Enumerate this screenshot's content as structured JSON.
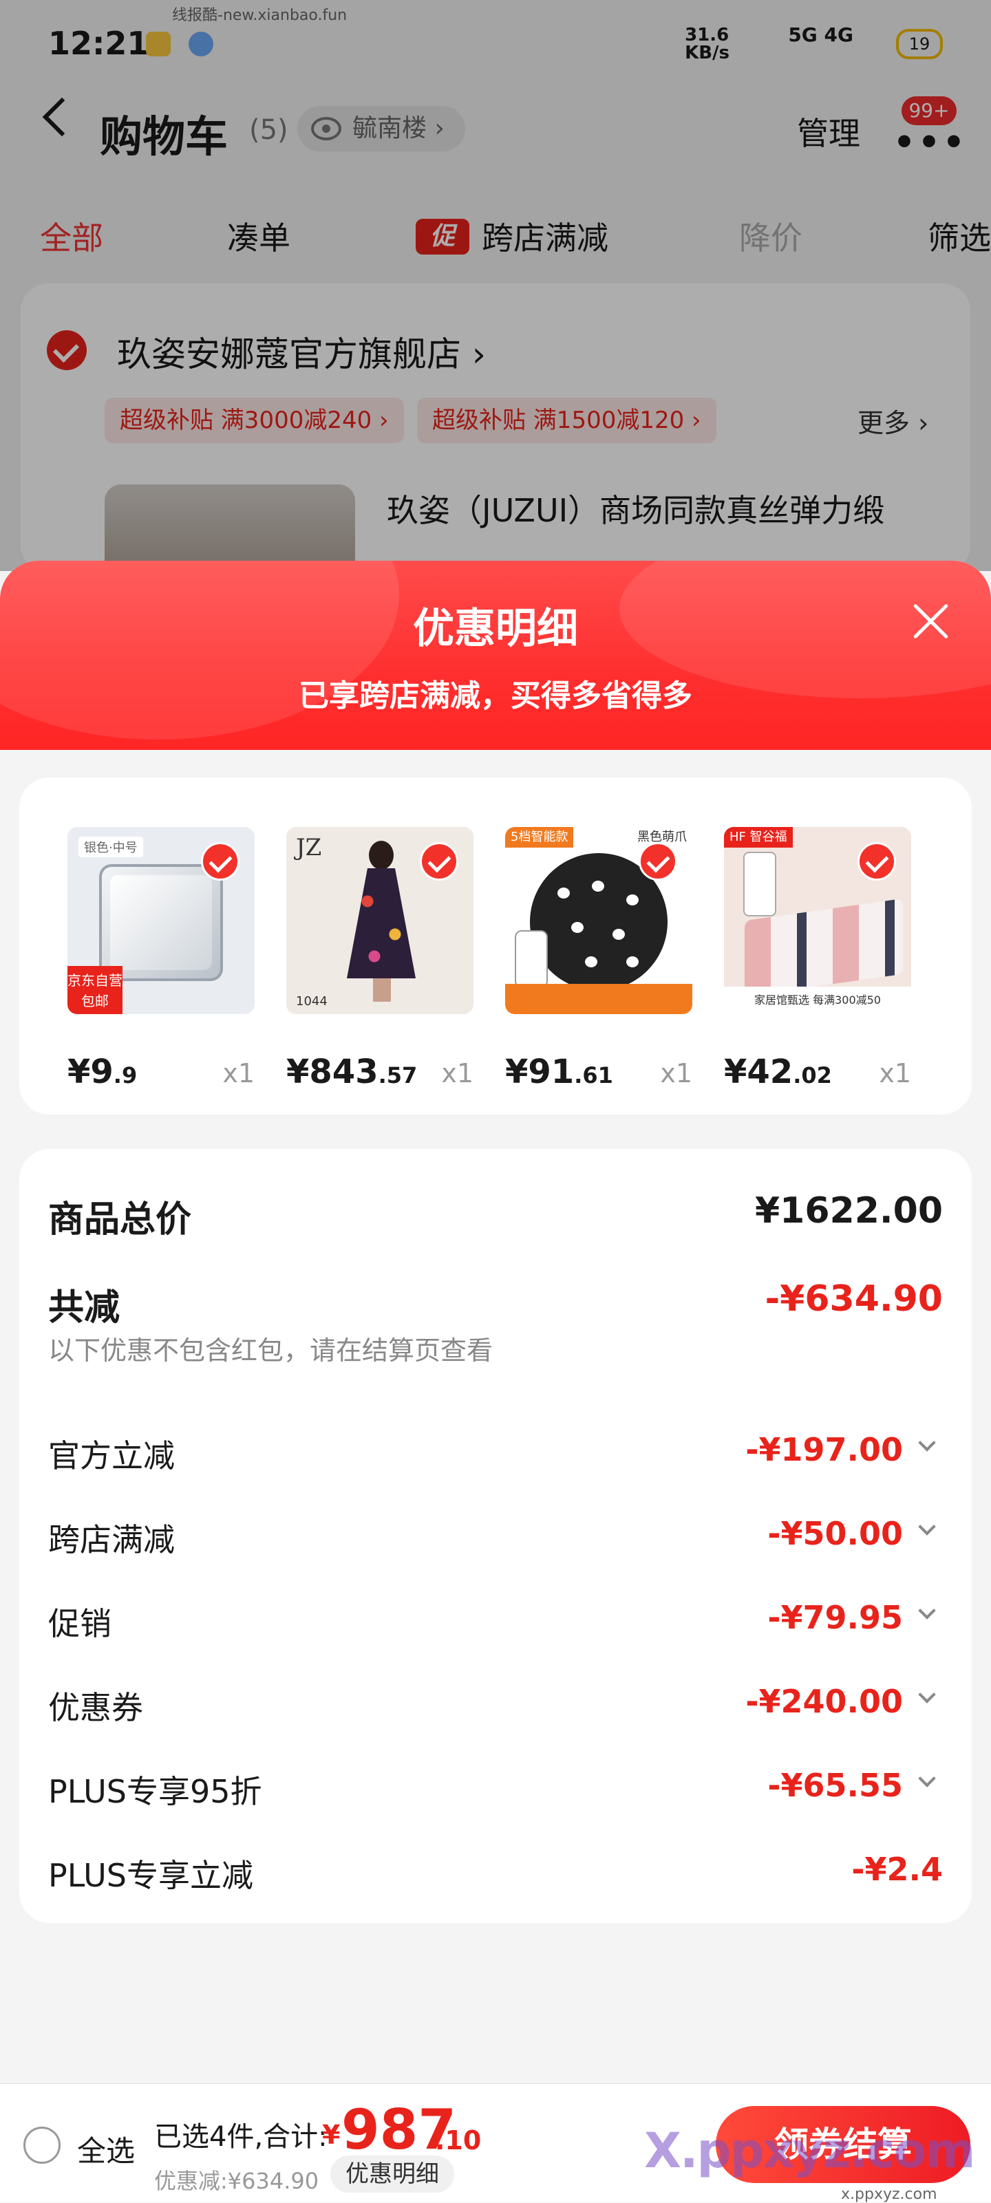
{
  "status_bar": {
    "time": "12:21",
    "watermark_top": "线报酷-new.xianbao.fun",
    "net_speed": "31.6\nKB/s",
    "signal": "5G 4G",
    "battery": "19"
  },
  "header": {
    "title": "购物车",
    "count": "(5)",
    "address": "毓南楼 ›",
    "manage": "管理",
    "more": "•••",
    "badge": "99+"
  },
  "tabs": [
    {
      "label": "全部"
    },
    {
      "label": "凑单"
    },
    {
      "label": "跨店满减",
      "tag": "促"
    },
    {
      "label": "降价"
    },
    {
      "label": "筛选"
    }
  ],
  "store": {
    "name": "玖姿安娜蔻官方旗舰店 ›",
    "promos": [
      "超级补贴  满3000减240 ›",
      "超级补贴  满1500减120 ›"
    ],
    "more": "更多 ›",
    "product_title": "玖姿（JUZUI）商场同款真丝弹力缎"
  },
  "sheet": {
    "title": "优惠明细",
    "subtitle": "已享跨店满减，买得多省得多",
    "items": [
      {
        "int": "¥9",
        "dec": ".9",
        "qty": "x1",
        "label_top": "银色·中号",
        "tag": "京东自营\n包邮"
      },
      {
        "int": "¥843",
        "dec": ".57",
        "qty": "x1",
        "logo": "JZ",
        "num": "1044"
      },
      {
        "int": "¥91",
        "dec": ".61",
        "qty": "x1",
        "tag_left": "5档智能款",
        "tag_right": "黑色萌爪"
      },
      {
        "int": "¥42",
        "dec": ".02",
        "qty": "x1",
        "tag": "HF 智谷福",
        "band": "家居馆甄选  每满300减50"
      }
    ],
    "detail": {
      "total_label": "商品总价",
      "total_value": "¥1622.00",
      "reduce_label": "共减",
      "reduce_value": "-¥634.90",
      "note": "以下优惠不包含红包，请在结算页查看",
      "lines": [
        {
          "label": "官方立减",
          "value": "-¥197.00"
        },
        {
          "label": "跨店满减",
          "value": "-¥50.00"
        },
        {
          "label": "促销",
          "value": "-¥79.95"
        },
        {
          "label": "优惠券",
          "value": "-¥240.00"
        },
        {
          "label": "PLUS专享95折",
          "value": "-¥65.55"
        },
        {
          "label": "PLUS专享立减",
          "value": "-¥2.4"
        }
      ]
    }
  },
  "bottom": {
    "select_all": "全选",
    "summary": "已选4件,合计:",
    "currency": "¥",
    "total_int": "987",
    "total_dec": ".10",
    "saved": "优惠减:¥634.90",
    "detail_btn": "优惠明细",
    "checkout": "领券结算",
    "wm_brand": "X.ppxyz.com",
    "wm_url": "x.ppxyz.com"
  },
  "colors": {
    "accent": "#e8231b",
    "sheet_head": "#ff3a3a"
  }
}
